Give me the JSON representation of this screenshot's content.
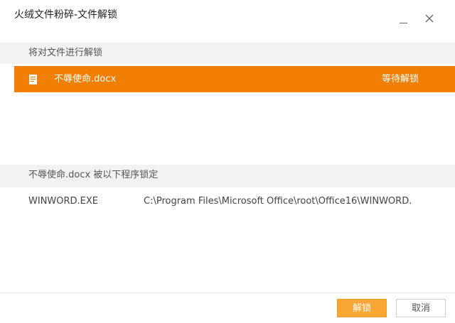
{
  "window": {
    "title": "火绒文件粉碎-文件解锁"
  },
  "files_section": {
    "header": "将对文件进行解锁",
    "items": [
      {
        "icon": "word-doc-icon",
        "name": "不辱使命.docx",
        "status": "等待解锁"
      }
    ]
  },
  "locks_section": {
    "header": "不辱使命.docx  被以下程序锁定",
    "processes": [
      {
        "name": "WINWORD.EXE",
        "path": "C:\\Program Files\\Microsoft Office\\root\\Office16\\WINWORD."
      }
    ]
  },
  "footer": {
    "unlock_label": "解锁",
    "cancel_label": "取消"
  },
  "colors": {
    "selected_row": "#f07f04",
    "primary_button": "#f8a634"
  }
}
